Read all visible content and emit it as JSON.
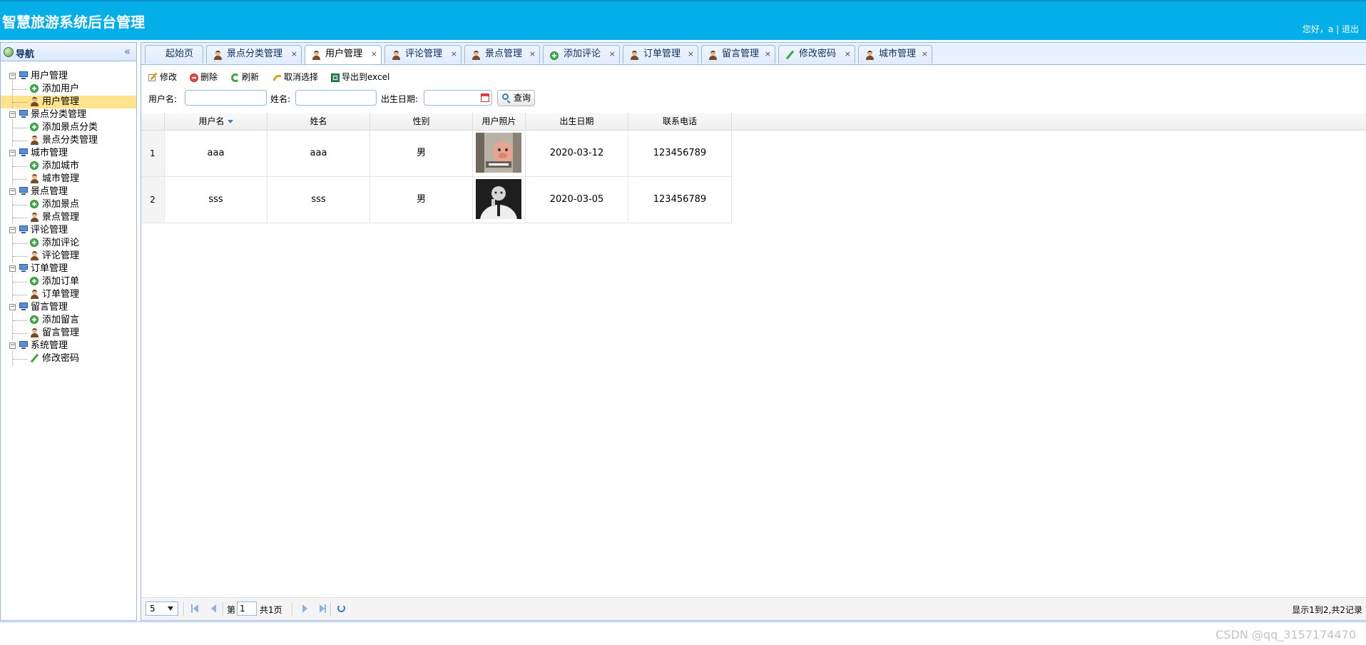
{
  "header": {
    "title": "智慧旅游系统后台管理",
    "greeting": "您好，a",
    "separator": "|",
    "logout": "退出",
    "bg_color": "#04aee9"
  },
  "nav": {
    "title": "导航",
    "collapse_icon": "«",
    "groups": [
      {
        "label": "用户管理",
        "children": [
          {
            "label": "添加用户",
            "icon": "add-icon"
          },
          {
            "label": "用户管理",
            "icon": "user-icon",
            "selected": true
          }
        ]
      },
      {
        "label": "景点分类管理",
        "children": [
          {
            "label": "添加景点分类",
            "icon": "add-icon"
          },
          {
            "label": "景点分类管理",
            "icon": "user-icon"
          }
        ]
      },
      {
        "label": "城市管理",
        "children": [
          {
            "label": "添加城市",
            "icon": "add-icon"
          },
          {
            "label": "城市管理",
            "icon": "user-icon"
          }
        ]
      },
      {
        "label": "景点管理",
        "children": [
          {
            "label": "添加景点",
            "icon": "add-icon"
          },
          {
            "label": "景点管理",
            "icon": "user-icon"
          }
        ]
      },
      {
        "label": "评论管理",
        "children": [
          {
            "label": "添加评论",
            "icon": "add-icon"
          },
          {
            "label": "评论管理",
            "icon": "user-icon"
          }
        ]
      },
      {
        "label": "订单管理",
        "children": [
          {
            "label": "添加订单",
            "icon": "add-icon"
          },
          {
            "label": "订单管理",
            "icon": "user-icon"
          }
        ]
      },
      {
        "label": "留言管理",
        "children": [
          {
            "label": "添加留言",
            "icon": "add-icon"
          },
          {
            "label": "留言管理",
            "icon": "user-icon"
          }
        ]
      },
      {
        "label": "系统管理",
        "children": [
          {
            "label": "修改密码",
            "icon": "pen-icon"
          }
        ]
      }
    ]
  },
  "tabs": [
    {
      "label": "起始页",
      "icon": "",
      "closable": false
    },
    {
      "label": "景点分类管理",
      "icon": "user-icon",
      "closable": true
    },
    {
      "label": "用户管理",
      "icon": "user-icon",
      "closable": true,
      "active": true
    },
    {
      "label": "评论管理",
      "icon": "user-icon",
      "closable": true
    },
    {
      "label": "景点管理",
      "icon": "user-icon",
      "closable": true
    },
    {
      "label": "添加评论",
      "icon": "add-icon",
      "closable": true
    },
    {
      "label": "订单管理",
      "icon": "user-icon",
      "closable": true
    },
    {
      "label": "留言管理",
      "icon": "user-icon",
      "closable": true
    },
    {
      "label": "修改密码",
      "icon": "pen-icon",
      "closable": true
    },
    {
      "label": "城市管理",
      "icon": "user-icon",
      "closable": true
    }
  ],
  "tab_close": "×",
  "toolbar": {
    "edit": "修改",
    "delete": "删除",
    "refresh": "刷新",
    "cancel_select": "取消选择",
    "export": "导出到excel"
  },
  "search": {
    "username_label": "用户名:",
    "username_value": "",
    "name_label": "姓名:",
    "name_value": "",
    "birth_label": "出生日期:",
    "birth_value": "",
    "query": "查询"
  },
  "grid": {
    "columns": [
      "用户名",
      "姓名",
      "性别",
      "用户照片",
      "出生日期",
      "联系电话"
    ],
    "rows": [
      {
        "num": "1",
        "username": "aaa",
        "name": "aaa",
        "gender": "男",
        "birth": "2020-03-12",
        "phone": "123456789"
      },
      {
        "num": "2",
        "username": "sss",
        "name": "sss",
        "gender": "男",
        "birth": "2020-03-05",
        "phone": "123456789"
      }
    ]
  },
  "pager": {
    "page_size": "5",
    "page_prefix": "第",
    "page_value": "1",
    "page_total": "共1页",
    "info": "显示1到2,共2记录"
  },
  "watermark": "CSDN @qq_3157174470"
}
